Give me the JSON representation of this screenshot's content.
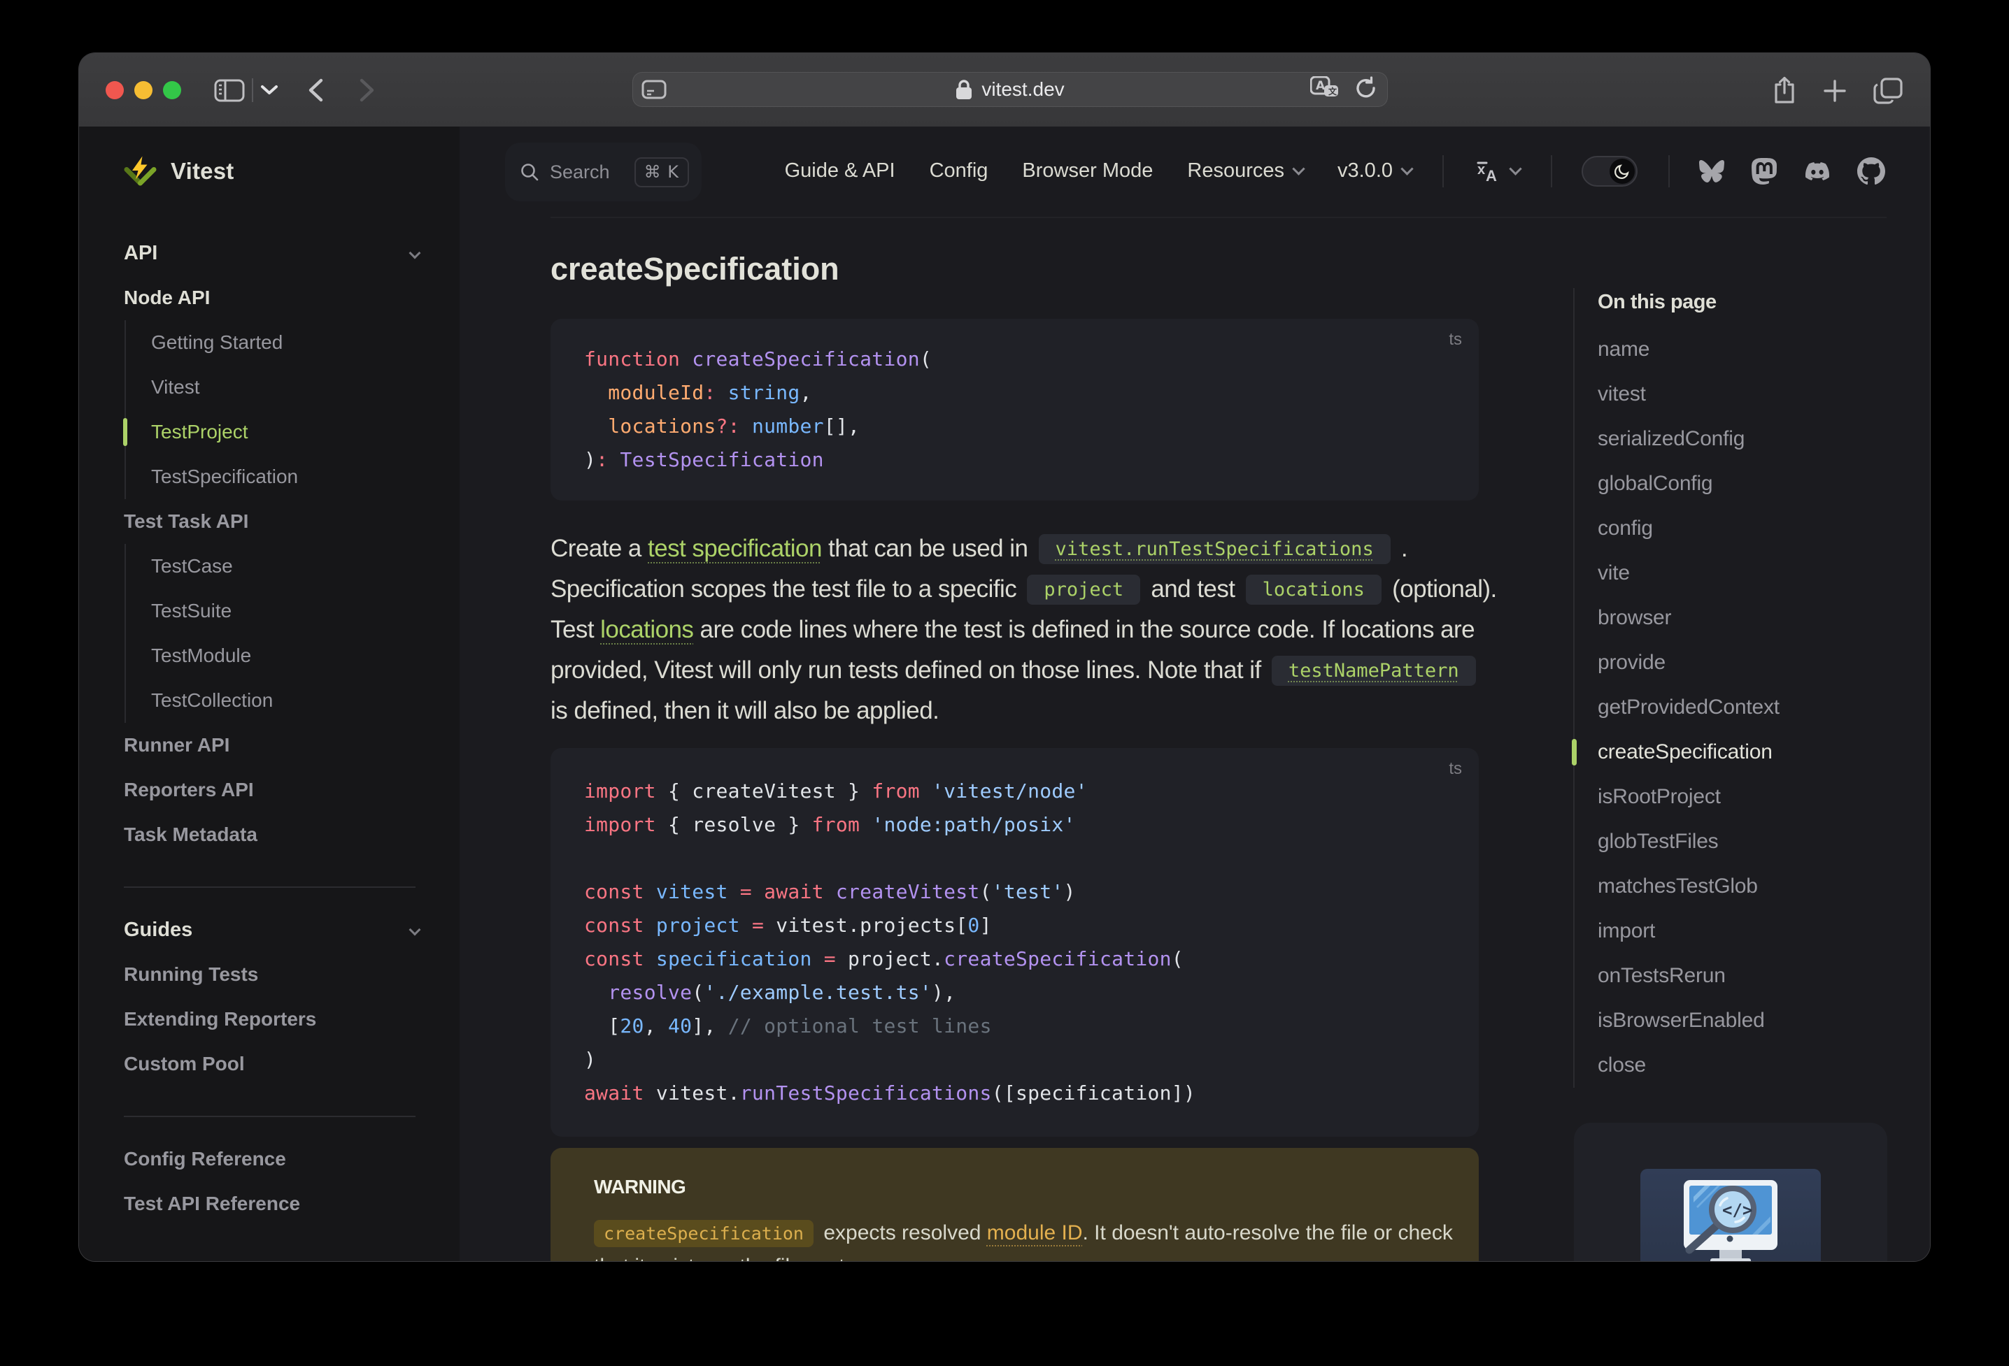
{
  "browser": {
    "url": "vitest.dev",
    "traffic_lights": [
      "close",
      "minimize",
      "zoom"
    ],
    "toolbar_icons": [
      "sidebar-toggle",
      "chevron-down",
      "back",
      "forward",
      "page-menu",
      "lock",
      "translate",
      "reload",
      "share",
      "new-tab",
      "tab-overview"
    ]
  },
  "navbar": {
    "logo_text": "Vitest",
    "search": {
      "label": "Search",
      "kbd": "⌘ K"
    },
    "links": [
      {
        "label": "Guide & API",
        "chevron": false
      },
      {
        "label": "Config",
        "chevron": false
      },
      {
        "label": "Browser Mode",
        "chevron": false
      },
      {
        "label": "Resources",
        "chevron": true
      },
      {
        "label": "v3.0.0",
        "chevron": true
      }
    ],
    "icons": [
      "language",
      "theme-toggle-dark",
      "bluesky",
      "mastodon",
      "discord",
      "github"
    ]
  },
  "sidebar": {
    "sections": [
      {
        "type": "top",
        "label": "API",
        "caret": true,
        "bright": true
      },
      {
        "type": "section",
        "label": "Node API",
        "bright": true
      },
      {
        "type": "group",
        "items": [
          {
            "label": "Getting Started"
          },
          {
            "label": "Vitest"
          },
          {
            "label": "TestProject",
            "active": true
          },
          {
            "label": "TestSpecification"
          }
        ]
      },
      {
        "type": "section",
        "label": "Test Task API"
      },
      {
        "type": "group",
        "items": [
          {
            "label": "TestCase"
          },
          {
            "label": "TestSuite"
          },
          {
            "label": "TestModule"
          },
          {
            "label": "TestCollection"
          }
        ]
      },
      {
        "type": "section",
        "label": "Runner API"
      },
      {
        "type": "section",
        "label": "Reporters API"
      },
      {
        "type": "section",
        "label": "Task Metadata"
      },
      {
        "type": "divider"
      },
      {
        "type": "top",
        "label": "Guides",
        "caret": true,
        "bright": true
      },
      {
        "type": "section",
        "label": "Running Tests"
      },
      {
        "type": "section",
        "label": "Extending Reporters"
      },
      {
        "type": "section",
        "label": "Custom Pool"
      },
      {
        "type": "divider"
      },
      {
        "type": "section",
        "label": "Config Reference"
      },
      {
        "type": "section",
        "label": "Test API Reference"
      }
    ]
  },
  "content": {
    "title": "createSpecification",
    "code_blocks": [
      {
        "lang": "ts",
        "lines": [
          [
            [
              "k",
              "function"
            ],
            [
              "p",
              " "
            ],
            [
              "f",
              "createSpecification"
            ],
            [
              "p",
              "("
            ]
          ],
          [
            [
              "p",
              "  "
            ],
            [
              "o",
              "moduleId"
            ],
            [
              "k",
              ":"
            ],
            [
              "p",
              " "
            ],
            [
              "n",
              "string"
            ],
            [
              "p",
              ","
            ]
          ],
          [
            [
              "p",
              "  "
            ],
            [
              "o",
              "locations"
            ],
            [
              "k",
              "?:"
            ],
            [
              "p",
              " "
            ],
            [
              "n",
              "number"
            ],
            [
              "p",
              "[],"
            ]
          ],
          [
            [
              "p",
              ")"
            ],
            [
              "k",
              ":"
            ],
            [
              "p",
              " "
            ],
            [
              "f",
              "TestSpecification"
            ]
          ]
        ]
      },
      {
        "lang": "ts",
        "lines": [
          [
            [
              "k",
              "import"
            ],
            [
              "p",
              " { createVitest } "
            ],
            [
              "k",
              "from"
            ],
            [
              "p",
              " "
            ],
            [
              "s",
              "'vitest/node'"
            ]
          ],
          [
            [
              "k",
              "import"
            ],
            [
              "p",
              " { resolve } "
            ],
            [
              "k",
              "from"
            ],
            [
              "p",
              " "
            ],
            [
              "s",
              "'node:path/posix'"
            ]
          ],
          [],
          [
            [
              "k",
              "const"
            ],
            [
              "p",
              " "
            ],
            [
              "n",
              "vitest"
            ],
            [
              "p",
              " "
            ],
            [
              "k",
              "="
            ],
            [
              "p",
              " "
            ],
            [
              "k",
              "await"
            ],
            [
              "p",
              " "
            ],
            [
              "f",
              "createVitest"
            ],
            [
              "p",
              "("
            ],
            [
              "s",
              "'test'"
            ],
            [
              "p",
              ")"
            ]
          ],
          [
            [
              "k",
              "const"
            ],
            [
              "p",
              " "
            ],
            [
              "n",
              "project"
            ],
            [
              "p",
              " "
            ],
            [
              "k",
              "="
            ],
            [
              "p",
              " vitest.projects["
            ],
            [
              "n",
              "0"
            ],
            [
              "p",
              "]"
            ]
          ],
          [
            [
              "k",
              "const"
            ],
            [
              "p",
              " "
            ],
            [
              "n",
              "specification"
            ],
            [
              "p",
              " "
            ],
            [
              "k",
              "="
            ],
            [
              "p",
              " project."
            ],
            [
              "f",
              "createSpecification"
            ],
            [
              "p",
              "("
            ]
          ],
          [
            [
              "p",
              "  "
            ],
            [
              "f",
              "resolve"
            ],
            [
              "p",
              "("
            ],
            [
              "s",
              "'./example.test.ts'"
            ],
            [
              "p",
              "),"
            ]
          ],
          [
            [
              "p",
              "  ["
            ],
            [
              "n",
              "20"
            ],
            [
              "p",
              ", "
            ],
            [
              "n",
              "40"
            ],
            [
              "p",
              "], "
            ],
            [
              "c",
              "// optional test lines"
            ]
          ],
          [
            [
              "p",
              ")"
            ]
          ],
          [
            [
              "k",
              "await"
            ],
            [
              "p",
              " vitest."
            ],
            [
              "f",
              "runTestSpecifications"
            ],
            [
              "p",
              "([specification])"
            ]
          ]
        ]
      }
    ],
    "paragraph_lines": [
      [
        [
          "t",
          "Create a "
        ],
        [
          "a",
          "test specification"
        ],
        [
          "t",
          " that can be used in "
        ],
        [
          "ca",
          "vitest.runTestSpecifications"
        ],
        [
          "t",
          " ."
        ]
      ],
      [
        [
          "t",
          "Specification scopes the test file to a specific "
        ],
        [
          "c",
          "project"
        ],
        [
          "t",
          " and test "
        ],
        [
          "c",
          "locations"
        ],
        [
          "t",
          " (optional)."
        ]
      ],
      [
        [
          "t",
          "Test "
        ],
        [
          "a",
          "locations"
        ],
        [
          "t",
          " are code lines where the test is defined in the source code. If locations are"
        ]
      ],
      [
        [
          "t",
          "provided, Vitest will only run tests defined on those lines. Note that if "
        ],
        [
          "ca",
          "testNamePattern"
        ]
      ],
      [
        [
          "t",
          "is defined, then it will also be applied."
        ]
      ]
    ],
    "warning": {
      "title": "WARNING",
      "lines": [
        [
          [
            "wc",
            "createSpecification"
          ],
          [
            "t",
            " expects resolved "
          ],
          [
            "wa",
            "module ID"
          ],
          [
            "t",
            ". It doesn't auto-resolve the file or check"
          ]
        ],
        [
          [
            "t",
            "that it exists on the file system."
          ]
        ]
      ]
    }
  },
  "aside": {
    "title": "On this page",
    "items": [
      "name",
      "vitest",
      "serializedConfig",
      "globalConfig",
      "config",
      "vite",
      "browser",
      "provide",
      "getProvidedContext",
      "createSpecification",
      "isRootProject",
      "globTestFiles",
      "matchesTestGlob",
      "import",
      "onTestsRerun",
      "isBrowserEnabled",
      "close"
    ],
    "active": "createSpecification",
    "ad_icon": "code-search-monitor"
  },
  "colors": {
    "brand_green": "#acd268",
    "logo_yellow": "#fcc72b",
    "logo_green": "#729b1b",
    "warning_bg": "#423a20",
    "warning_accent": "#dcaf4e",
    "code_bg": "#202127",
    "page_bg": "#1b1b1f",
    "sidebar_bg": "#161618"
  }
}
